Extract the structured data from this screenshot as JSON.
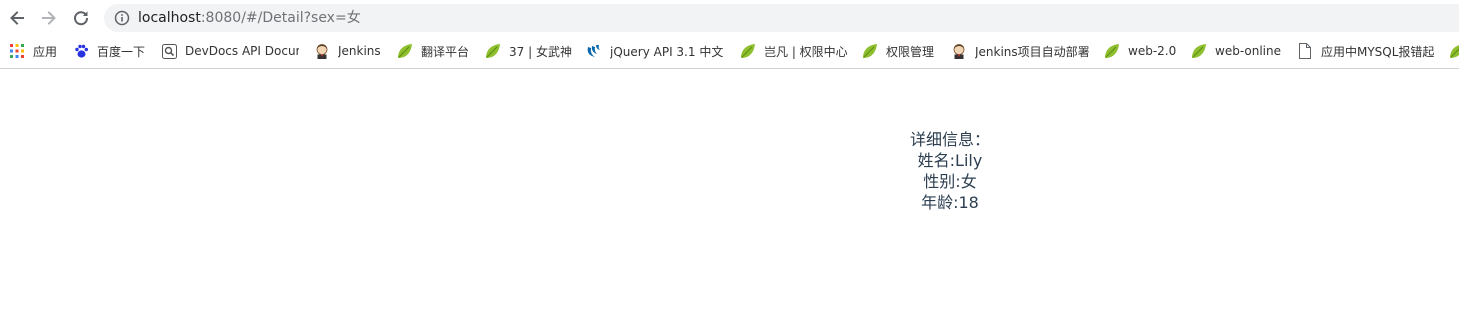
{
  "browser": {
    "url_host": "localhost",
    "url_path": ":8080/#/Detail?sex=女"
  },
  "bookmarks": [
    {
      "label": "应用",
      "icon": "apps-grid-icon"
    },
    {
      "label": "百度一下",
      "icon": "baidu-paw-icon"
    },
    {
      "label": "DevDocs API Docur",
      "icon": "devdocs-search-icon"
    },
    {
      "label": "Jenkins",
      "icon": "jenkins-butler-icon"
    },
    {
      "label": "翻译平台",
      "icon": "leaf-icon"
    },
    {
      "label": "37 | 女武神",
      "icon": "leaf-icon"
    },
    {
      "label": "jQuery API 3.1 中文",
      "icon": "jquery-swirl-icon"
    },
    {
      "label": "岂凡 | 权限中心",
      "icon": "leaf-icon"
    },
    {
      "label": "权限管理",
      "icon": "leaf-icon"
    },
    {
      "label": "Jenkins项目自动部署",
      "icon": "jenkins-butler-icon"
    },
    {
      "label": "web-2.0",
      "icon": "leaf-icon"
    },
    {
      "label": "web-online",
      "icon": "leaf-icon"
    },
    {
      "label": "应用中MYSQL报错起",
      "icon": "page-icon"
    },
    {
      "label": "",
      "icon": "leaf-icon"
    }
  ],
  "detail": {
    "heading": "详细信息：",
    "name_line": "姓名:Lily",
    "sex_line": "性别:女",
    "age_line": "年龄:18"
  },
  "colors": {
    "leaf": "#8dbf2e",
    "text": "#2c3e50",
    "omnibox": "#f1f3f4"
  }
}
